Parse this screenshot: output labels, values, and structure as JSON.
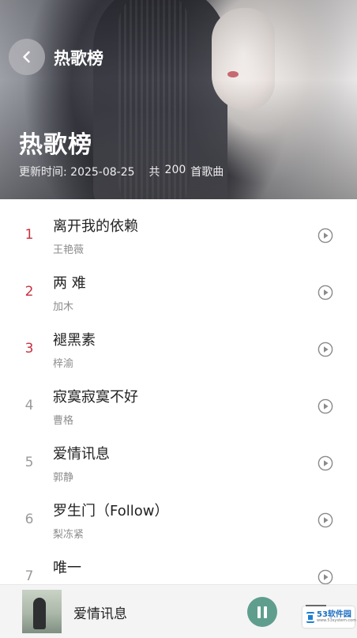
{
  "header": {
    "title": "热歌榜",
    "big_title": "热歌榜",
    "update_label": "更新时间:",
    "update_date": "2025-08-25",
    "count_prefix": "共",
    "count": "200",
    "count_suffix": "首歌曲",
    "back_icon": "chevron-left-icon"
  },
  "songs": [
    {
      "rank": "1",
      "title": "离开我的依赖",
      "artist": "王艳薇"
    },
    {
      "rank": "2",
      "title": "两 难",
      "artist": "加木"
    },
    {
      "rank": "3",
      "title": "褪黑素",
      "artist": "梓渝"
    },
    {
      "rank": "4",
      "title": "寂寞寂寞不好",
      "artist": "曹格"
    },
    {
      "rank": "5",
      "title": "爱情讯息",
      "artist": "郭静"
    },
    {
      "rank": "6",
      "title": "罗生门（Follow）",
      "artist": "梨冻紧"
    },
    {
      "rank": "7",
      "title": "唯一",
      "artist": ""
    }
  ],
  "player": {
    "now_playing": "爱情讯息",
    "pause_icon": "pause-icon",
    "queue_icon": "playlist-icon"
  },
  "watermark": {
    "text": "53软件园",
    "sub": "www.53system.com"
  },
  "colors": {
    "top_rank": "#c8303e",
    "rank": "#9a9a9a",
    "accent": "#5f9e8d"
  }
}
